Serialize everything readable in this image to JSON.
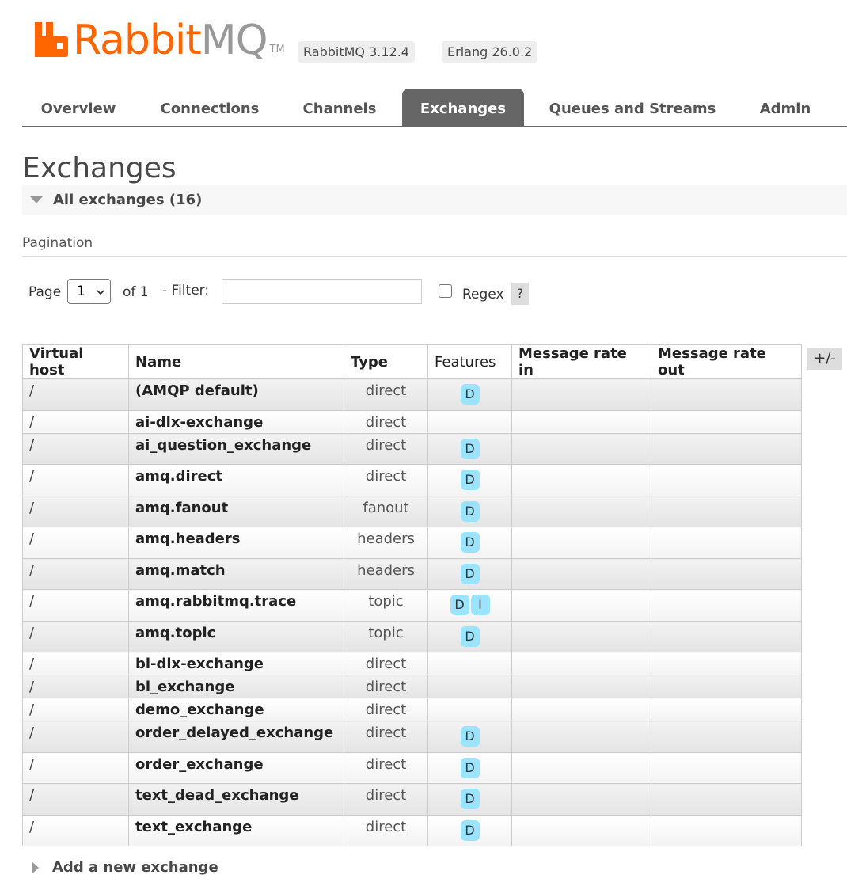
{
  "brand": {
    "name_part1": "Rabbit",
    "name_part2": "MQ",
    "tm": "TM",
    "colors": {
      "orange": "#ff6600",
      "grey": "#999999"
    }
  },
  "versions": {
    "rabbitmq": "RabbitMQ 3.12.4",
    "erlang": "Erlang 26.0.2"
  },
  "tabs": [
    {
      "label": "Overview",
      "active": false
    },
    {
      "label": "Connections",
      "active": false
    },
    {
      "label": "Channels",
      "active": false
    },
    {
      "label": "Exchanges",
      "active": true
    },
    {
      "label": "Queues and Streams",
      "active": false
    },
    {
      "label": "Admin",
      "active": false
    }
  ],
  "page": {
    "title": "Exchanges",
    "section_title": "All exchanges (16)"
  },
  "pagination": {
    "label": "Pagination",
    "page_label": "Page",
    "page_value": "1",
    "of_label": "of 1",
    "filter_label": "- Filter:",
    "filter_value": "",
    "regex_label": "Regex",
    "regex_checked": false,
    "help_label": "?"
  },
  "table": {
    "headers": [
      "Virtual host",
      "Name",
      "Type",
      "Features",
      "Message rate in",
      "Message rate out"
    ],
    "columns_toggle": "+/-",
    "rows": [
      {
        "vhost": "/",
        "name": "(AMQP default)",
        "type": "direct",
        "features": [
          "D"
        ],
        "rate_in": "",
        "rate_out": ""
      },
      {
        "vhost": "/",
        "name": "ai-dlx-exchange",
        "type": "direct",
        "features": [],
        "rate_in": "",
        "rate_out": ""
      },
      {
        "vhost": "/",
        "name": "ai_question_exchange",
        "type": "direct",
        "features": [
          "D"
        ],
        "rate_in": "",
        "rate_out": ""
      },
      {
        "vhost": "/",
        "name": "amq.direct",
        "type": "direct",
        "features": [
          "D"
        ],
        "rate_in": "",
        "rate_out": ""
      },
      {
        "vhost": "/",
        "name": "amq.fanout",
        "type": "fanout",
        "features": [
          "D"
        ],
        "rate_in": "",
        "rate_out": ""
      },
      {
        "vhost": "/",
        "name": "amq.headers",
        "type": "headers",
        "features": [
          "D"
        ],
        "rate_in": "",
        "rate_out": ""
      },
      {
        "vhost": "/",
        "name": "amq.match",
        "type": "headers",
        "features": [
          "D"
        ],
        "rate_in": "",
        "rate_out": ""
      },
      {
        "vhost": "/",
        "name": "amq.rabbitmq.trace",
        "type": "topic",
        "features": [
          "D",
          "I"
        ],
        "rate_in": "",
        "rate_out": ""
      },
      {
        "vhost": "/",
        "name": "amq.topic",
        "type": "topic",
        "features": [
          "D"
        ],
        "rate_in": "",
        "rate_out": ""
      },
      {
        "vhost": "/",
        "name": "bi-dlx-exchange",
        "type": "direct",
        "features": [],
        "rate_in": "",
        "rate_out": ""
      },
      {
        "vhost": "/",
        "name": "bi_exchange",
        "type": "direct",
        "features": [],
        "rate_in": "",
        "rate_out": ""
      },
      {
        "vhost": "/",
        "name": "demo_exchange",
        "type": "direct",
        "features": [],
        "rate_in": "",
        "rate_out": ""
      },
      {
        "vhost": "/",
        "name": "order_delayed_exchange",
        "type": "direct",
        "features": [
          "D"
        ],
        "rate_in": "",
        "rate_out": ""
      },
      {
        "vhost": "/",
        "name": "order_exchange",
        "type": "direct",
        "features": [
          "D"
        ],
        "rate_in": "",
        "rate_out": ""
      },
      {
        "vhost": "/",
        "name": "text_dead_exchange",
        "type": "direct",
        "features": [
          "D"
        ],
        "rate_in": "",
        "rate_out": ""
      },
      {
        "vhost": "/",
        "name": "text_exchange",
        "type": "direct",
        "features": [
          "D"
        ],
        "rate_in": "",
        "rate_out": ""
      }
    ]
  },
  "add_section": {
    "label": "Add a new exchange"
  }
}
